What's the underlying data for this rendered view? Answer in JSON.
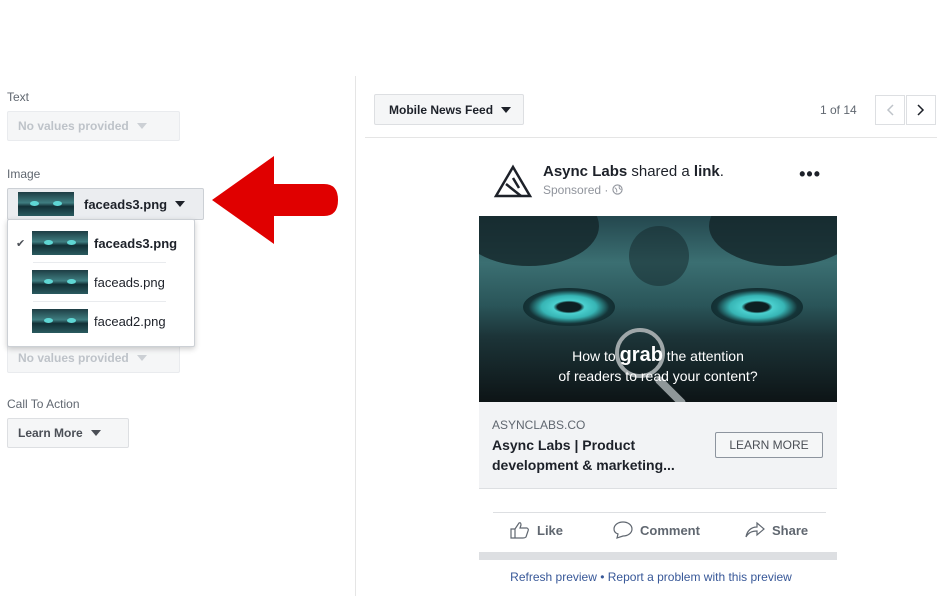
{
  "left_panel": {
    "text_label": "Text",
    "text_value": "No values provided",
    "image_label": "Image",
    "image_selected": "faceads3.png",
    "image_options": [
      {
        "label": "faceads3.png",
        "selected": true
      },
      {
        "label": "faceads.png",
        "selected": false
      },
      {
        "label": "facead2.png",
        "selected": false
      }
    ],
    "hidden_field_value": "No values provided",
    "cta_label": "Call To Action",
    "cta_value": "Learn More"
  },
  "right_panel": {
    "placement": "Mobile News Feed",
    "pager": "1 of 14",
    "post": {
      "page_name": "Async Labs",
      "shared_text": "shared a",
      "shared_object": "link",
      "shared_period": ".",
      "sponsored": "Sponsored · ",
      "more": "•••",
      "image_caption_pre": "How to ",
      "image_caption_bold": "grab",
      "image_caption_post": " the attention",
      "image_caption_line2": "of readers to read your content?",
      "domain": "ASYNCLABS.CO",
      "headline": "Async Labs | Product development & marketing...",
      "cta_button": "LEARN MORE",
      "like": "Like",
      "comment": "Comment",
      "share": "Share"
    },
    "footer": {
      "refresh": "Refresh preview",
      "separator": " • ",
      "report": "Report a problem with this preview"
    }
  },
  "colors": {
    "arrow": "#e00000",
    "link": "#385898",
    "muted": "#606770"
  },
  "icons": [
    "check-icon",
    "caret-down-icon",
    "chevron-left-icon",
    "chevron-right-icon",
    "globe-icon",
    "like-icon",
    "comment-icon",
    "share-icon",
    "red-arrow-annotation"
  ]
}
